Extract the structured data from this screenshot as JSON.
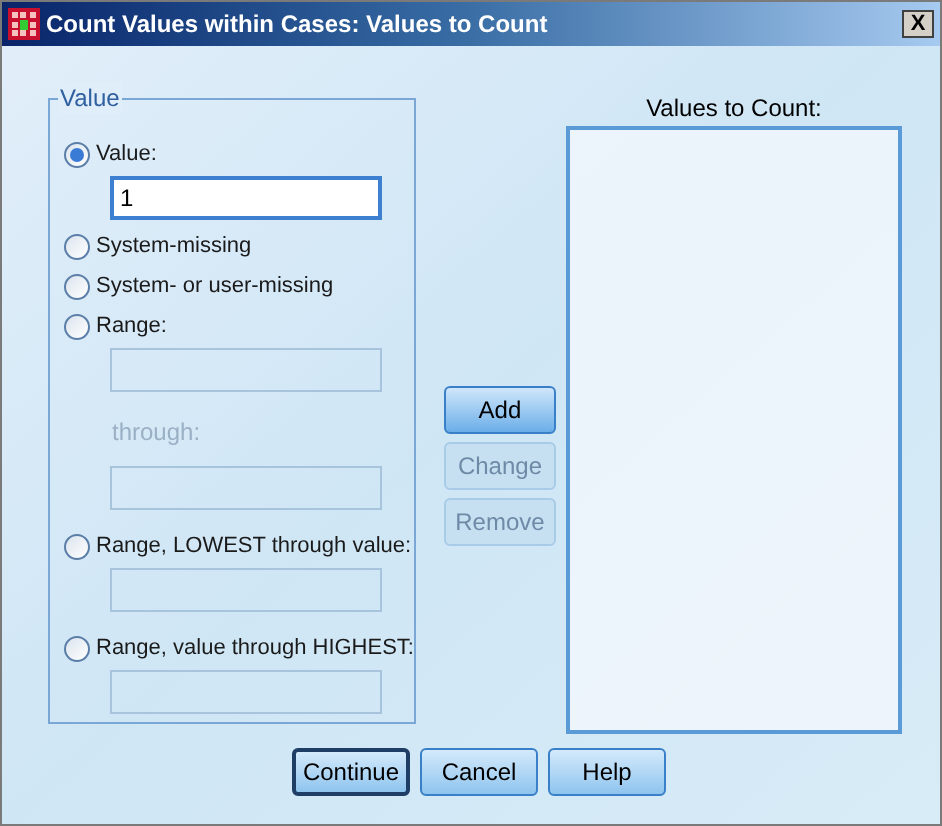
{
  "window": {
    "title": "Count Values within Cases: Values to Count",
    "close": "X"
  },
  "value_group": {
    "legend": "Value",
    "options": [
      {
        "kind": "radio",
        "label": "Value:",
        "selected": true,
        "fields": [
          {
            "value": "1",
            "disabled": false
          }
        ]
      },
      {
        "kind": "radio",
        "label": "System-missing",
        "selected": false
      },
      {
        "kind": "radio",
        "label": "System- or user-missing",
        "selected": false
      },
      {
        "kind": "radio",
        "label": "Range:",
        "selected": false,
        "fields": [
          {
            "disabled": true
          },
          {
            "label": "through:",
            "disabled": true
          }
        ]
      },
      {
        "kind": "radio",
        "label": "Range, LOWEST through value:",
        "selected": false,
        "fields": [
          {
            "disabled": true
          }
        ]
      },
      {
        "kind": "radio",
        "label": "Range, value through HIGHEST:",
        "selected": false,
        "fields": [
          {
            "disabled": true
          }
        ]
      }
    ]
  },
  "list_buttons": [
    {
      "label": "Add",
      "disabled": false
    },
    {
      "label": "Change",
      "disabled": true
    },
    {
      "label": "Remove",
      "disabled": true
    }
  ],
  "values_list": {
    "label": "Values to Count:"
  },
  "footer_buttons": [
    {
      "label": "Continue",
      "default": true
    },
    {
      "label": "Cancel",
      "default": false
    },
    {
      "label": "Help",
      "default": false
    }
  ]
}
